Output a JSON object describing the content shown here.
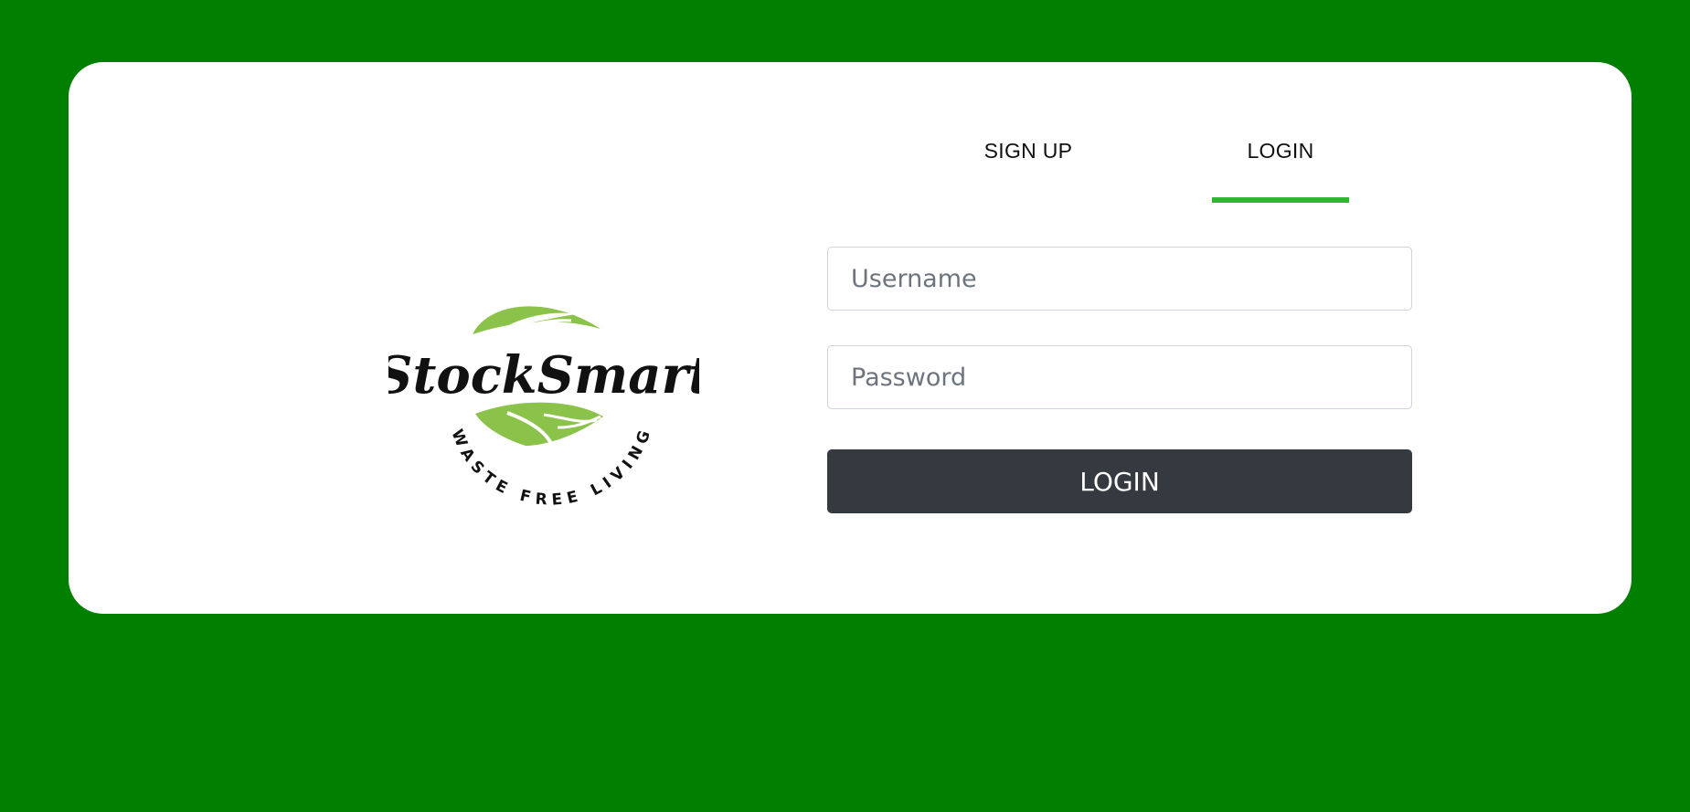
{
  "brand": {
    "name": "StockSmart",
    "tagline": "WASTE FREE LIVING",
    "leaf_color": "#8bc34a"
  },
  "tabs": [
    {
      "label": "SIGN UP",
      "active": false
    },
    {
      "label": "LOGIN",
      "active": true
    }
  ],
  "form": {
    "username_placeholder": "Username",
    "password_placeholder": "Password",
    "submit_label": "LOGIN"
  },
  "colors": {
    "background": "#007f00",
    "card": "#ffffff",
    "active_tab_underline": "#2db82d",
    "button": "#343a40"
  }
}
